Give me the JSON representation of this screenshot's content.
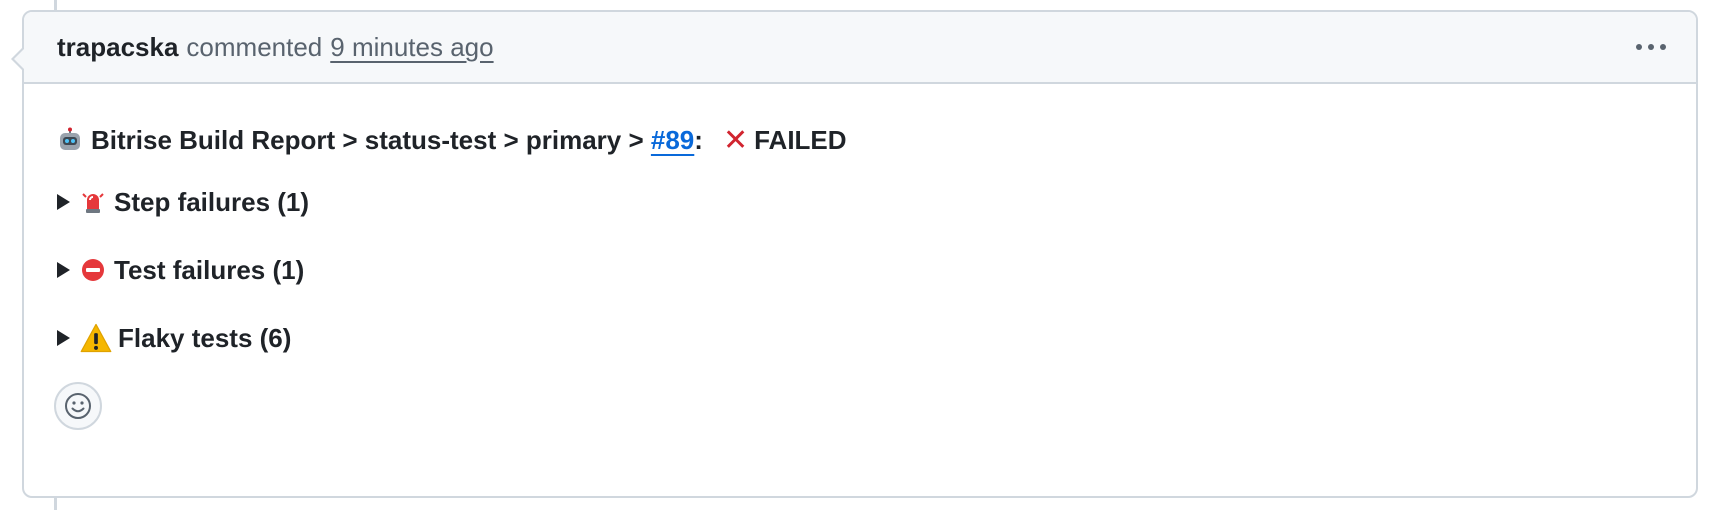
{
  "comment": {
    "author": "trapacska",
    "action": "commented",
    "timestamp": "9 minutes ago"
  },
  "report": {
    "prefix": "Bitrise Build Report > status-test > primary > ",
    "build_link": "#89",
    "colon": ":",
    "status": "FAILED",
    "icon": "robot-icon",
    "status_icon": "cross-mark-icon"
  },
  "sections": [
    {
      "label": "Step failures (1)",
      "icon": "rotating-light-icon"
    },
    {
      "label": "Test failures (1)",
      "icon": "no-entry-icon"
    },
    {
      "label": "Flaky tests (6)",
      "icon": "warning-icon"
    }
  ],
  "colors": {
    "link": "#0969da",
    "fail": "#d1242f",
    "warning": "#f5b700",
    "border": "#d0d7de",
    "header_bg": "#f6f8fa"
  }
}
